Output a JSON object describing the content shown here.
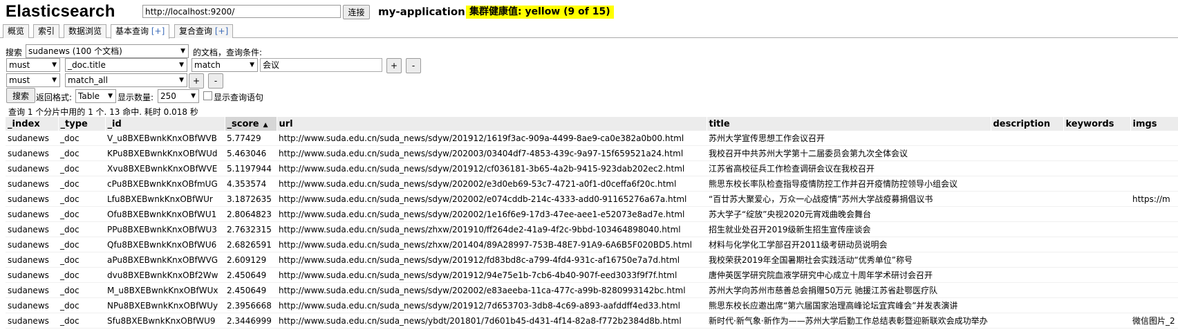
{
  "header": {
    "app_title": "Elasticsearch",
    "url_value": "http://localhost:9200/",
    "connect_label": "连接",
    "cluster_name": "my-application",
    "health_status": "集群健康值: yellow (9 of 15)",
    "health_color": "#ffff00"
  },
  "tabs": [
    {
      "label": "概览"
    },
    {
      "label": "索引"
    },
    {
      "label": "数据浏览"
    },
    {
      "label": "基本查询",
      "plus": "[+]"
    },
    {
      "label": "复合查询",
      "plus": "[+]"
    }
  ],
  "query": {
    "search_label": "搜索",
    "index_select": "sudanews (100 个文档)",
    "doc_label": "的文档，查询条件:",
    "row1": {
      "bool": "must",
      "field": "_doc.title",
      "op": "match",
      "value": "会议"
    },
    "row2": {
      "bool": "must",
      "field": "match_all"
    },
    "plus": "+",
    "minus": "-",
    "search_button": "搜索",
    "format_label": "返回格式:",
    "format_value": "Table",
    "size_label": "显示数量:",
    "size_value": "250",
    "show_query_label": "显示查询语句",
    "summary": "查询 1 个分片中用的 1 个. 13 命中. 耗时 0.018 秒"
  },
  "table": {
    "columns": [
      "_index",
      "_type",
      "_id",
      "_score",
      "url",
      "title",
      "description",
      "keywords",
      "imgs"
    ],
    "sorted_column": "_score",
    "sort_arrow": "▲",
    "rows": [
      [
        "sudanews",
        "_doc",
        "V_u8BXEBwnkKnxOBfWVB",
        "5.77429",
        "http://www.suda.edu.cn/suda_news/sdyw/201912/1619f3ac-909a-4499-8ae9-ca0e382a0b00.html",
        "苏州大学宣传思想工作会议召开",
        "",
        "",
        ""
      ],
      [
        "sudanews",
        "_doc",
        "KPu8BXEBwnkKnxOBfWUd",
        "5.463046",
        "http://www.suda.edu.cn/suda_news/sdyw/202003/03404df7-4853-439c-9a97-15f659521a24.html",
        "我校召开中共苏州大学第十二届委员会第九次全体会议",
        "",
        "",
        ""
      ],
      [
        "sudanews",
        "_doc",
        "Xvu8BXEBwnkKnxOBfWVE",
        "5.1197944",
        "http://www.suda.edu.cn/suda_news/sdyw/201912/cf036181-3b65-4a2b-9415-923dab202ec2.html",
        "江苏省高校征兵工作检查调研会议在我校召开",
        "",
        "",
        ""
      ],
      [
        "sudanews",
        "_doc",
        "cPu8BXEBwnkKnxOBfmUG",
        "4.353574",
        "http://www.suda.edu.cn/suda_news/sdyw/202002/e3d0eb69-53c7-4721-a0f1-d0ceffa6f20c.html",
        "熊思东校长率队检查指导疫情防控工作并召开疫情防控领导小组会议",
        "",
        "",
        ""
      ],
      [
        "sudanews",
        "_doc",
        "Lfu8BXEBwnkKnxOBfWUr",
        "3.1872635",
        "http://www.suda.edu.cn/suda_news/sdyw/202002/e074cddb-214c-4333-add0-91165276a67a.html",
        "“百廿苏大聚爱心，万众一心战疫情”苏州大学战疫募捐倡议书",
        "",
        "",
        "https://m"
      ],
      [
        "sudanews",
        "_doc",
        "Ofu8BXEBwnkKnxOBfWU1",
        "2.8064823",
        "http://www.suda.edu.cn/suda_news/sdyw/202002/1e16f6e9-17d3-47ee-aee1-e52073e8ad7e.html",
        "苏大学子“绽放”央视2020元宵戏曲晚会舞台",
        "",
        "",
        ""
      ],
      [
        "sudanews",
        "_doc",
        "PPu8BXEBwnkKnxOBfWU3",
        "2.7632315",
        "http://www.suda.edu.cn/suda_news/zhxw/201910/ff264de2-41a9-4f2c-9bbd-103464898040.html",
        "招生就业处召开2019级新生招生宣传座谈会",
        "",
        "",
        ""
      ],
      [
        "sudanews",
        "_doc",
        "Qfu8BXEBwnkKnxOBfWU6",
        "2.6826591",
        "http://www.suda.edu.cn/suda_news/zhxw/201404/89A28997-753B-48E7-91A9-6A6B5F020BD5.html",
        "材料与化学化工学部召开2011级考研动员说明会",
        "",
        "",
        ""
      ],
      [
        "sudanews",
        "_doc",
        "aPu8BXEBwnkKnxOBfWVG",
        "2.609129",
        "http://www.suda.edu.cn/suda_news/sdyw/201912/fd83bd8c-a799-4fd4-931c-af16750e7a7d.html",
        "我校荣获2019年全国暑期社会实践活动“优秀单位”称号",
        "",
        "",
        ""
      ],
      [
        "sudanews",
        "_doc",
        "dvu8BXEBwnkKnxOBf2Ww",
        "2.450649",
        "http://www.suda.edu.cn/suda_news/sdyw/201912/94e75e1b-7cb6-4b40-907f-eed3033f9f7f.html",
        "唐仲英医学研究院血液学研究中心成立十周年学术研讨会召开",
        "",
        "",
        ""
      ],
      [
        "sudanews",
        "_doc",
        "M_u8BXEBwnkKnxOBfWUx",
        "2.450649",
        "http://www.suda.edu.cn/suda_news/sdyw/202002/e83aeeba-11ca-477c-a99b-8280993142bc.html",
        "苏州大学向苏州市慈善总会捐赠50万元 驰援江苏省赴鄂医疗队",
        "",
        "",
        ""
      ],
      [
        "sudanews",
        "_doc",
        "NPu8BXEBwnkKnxOBfWUy",
        "2.3956668",
        "http://www.suda.edu.cn/suda_news/sdyw/201912/7d653703-3db8-4c69-a893-aafddff4ed33.html",
        "熊思东校长应邀出席“第六届国家治理高峰论坛宜宾峰会”并发表演讲",
        "",
        "",
        ""
      ],
      [
        "sudanews",
        "_doc",
        "Sfu8BXEBwnkKnxOBfWU9",
        "2.3446999",
        "http://www.suda.edu.cn/suda_news/ybdt/201801/7d601b45-d431-4f14-82a8-f772b2384d8b.html",
        "新时代·新气象·新作为——苏州大学后勤工作总结表彰暨迎新联欢会成功举办",
        "",
        "",
        "微信图片_2"
      ]
    ]
  }
}
